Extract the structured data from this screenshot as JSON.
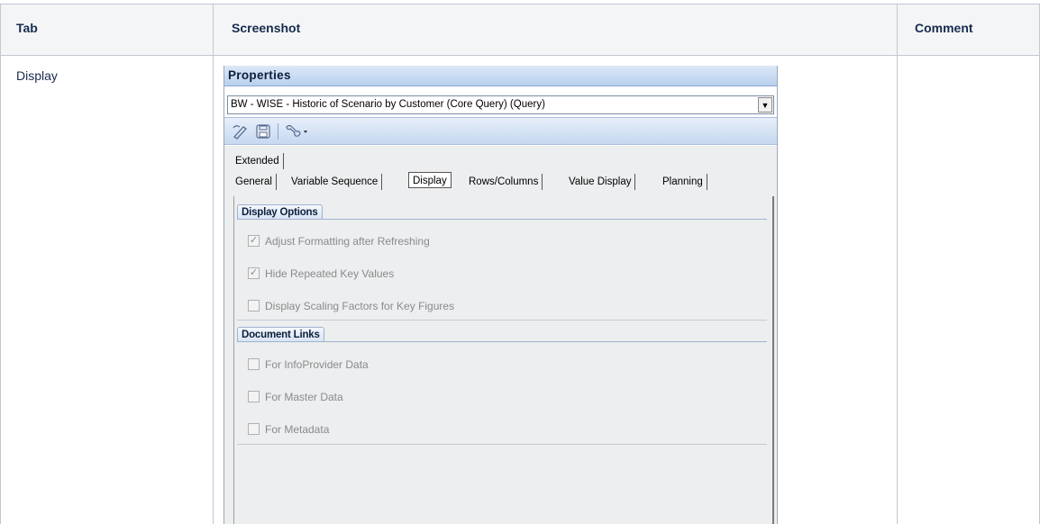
{
  "table": {
    "headers": {
      "tab": "Tab",
      "screenshot": "Screenshot",
      "comment": "Comment"
    },
    "row": {
      "tab": "Display",
      "comment": ""
    }
  },
  "panel": {
    "title": "Properties",
    "query_value": "BW - WISE - Historic of Scenario by Customer (Core Query) (Query)",
    "dropdown_glyph": "▼",
    "toolbar_icons": [
      "pencil-icon",
      "save-icon",
      "tools-icon"
    ],
    "tabs_row1": [
      "Extended"
    ],
    "tabs_row2": [
      "General",
      "Variable Sequence",
      "Display",
      "Rows/Columns",
      "Value Display",
      "Planning"
    ],
    "active_tab": "Display",
    "groups": {
      "display_options": {
        "title": "Display Options",
        "options": [
          {
            "label": "Adjust Formatting after Refreshing",
            "checked": true
          },
          {
            "label": "Hide Repeated Key Values",
            "checked": true
          },
          {
            "label": "Display Scaling Factors for Key Figures",
            "checked": false
          }
        ]
      },
      "document_links": {
        "title": "Document Links",
        "options": [
          {
            "label": "For InfoProvider Data",
            "checked": false
          },
          {
            "label": "For Master Data",
            "checked": false
          },
          {
            "label": "For Metadata",
            "checked": false
          }
        ]
      }
    },
    "check_glyph": "✓"
  },
  "colors": {
    "title_bar": "#b9d0ee",
    "toolbar": "#c6d8f0",
    "disabled_text": "#8a8a8a",
    "header_bg": "#f4f5f7"
  }
}
